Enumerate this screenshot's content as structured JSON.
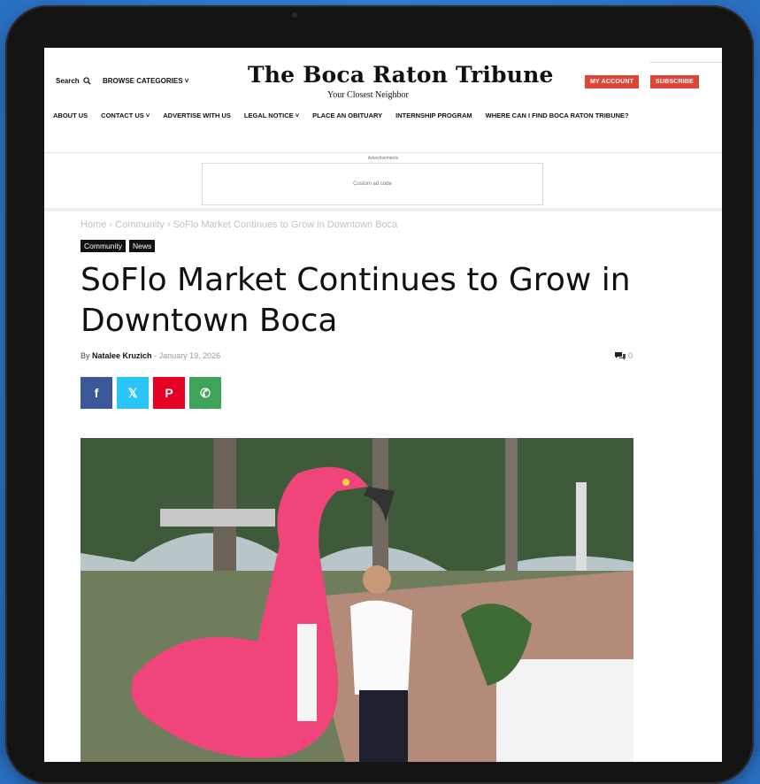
{
  "header": {
    "search_label": "Search",
    "browse_label": "BROWSE CATEGORIES",
    "logo": "The Boca Raton Tribune",
    "tagline": "Your Closest Neighbor",
    "account_label": "MY ACCOUNT",
    "subscribe_label": "SUBSCRIBE"
  },
  "nav": [
    "ABOUT US",
    "CONTACT US",
    "ADVERTISE WITH US",
    "LEGAL NOTICE",
    "PLACE AN OBITUARY",
    "INTERNSHIP PROGRAM",
    "WHERE CAN I FIND BOCA RATON TRIBUNE?"
  ],
  "ad": {
    "label": "Advertisements",
    "placeholder": "Custom ad code"
  },
  "breadcrumb": [
    "Home",
    "Community",
    "SoFlo Market Continues to Grow in Downtown Boca"
  ],
  "tags": [
    "Community",
    "News"
  ],
  "article": {
    "title": "SoFlo Market Continues to Grow in Downtown Boca",
    "by": "By",
    "author": "Natalee Kruzich",
    "date": "January 19, 2026",
    "comments": "0"
  },
  "share": [
    {
      "icon": "facebook-icon",
      "glyph": "f",
      "color": "#3b5998"
    },
    {
      "icon": "x-icon",
      "glyph": "𝕏",
      "color": "#29c5f6"
    },
    {
      "icon": "pinterest-icon",
      "glyph": "P",
      "color": "#e60023"
    },
    {
      "icon": "whatsapp-icon",
      "glyph": "✆",
      "color": "#3fa35a"
    }
  ],
  "colors": {
    "accent": "#e0453a",
    "brand_text": "#111111"
  }
}
